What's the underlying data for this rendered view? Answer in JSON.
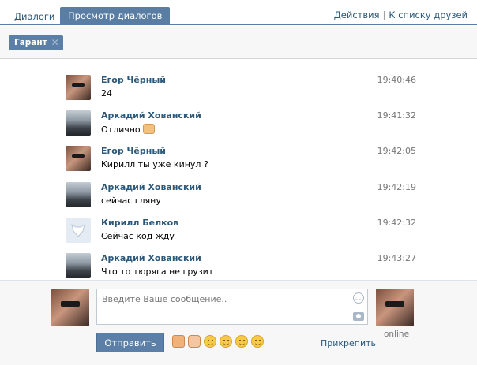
{
  "tabs": [
    {
      "label": "Диалоги",
      "active": false
    },
    {
      "label": "Просмотр диалогов",
      "active": true
    }
  ],
  "header_actions": {
    "actions": "Действия",
    "separator": "|",
    "friends": "К списку друзей"
  },
  "filter_chip": {
    "label": "Гарант"
  },
  "messages": [
    {
      "author": "Егор Чёрный",
      "text": "24",
      "time": "19:40:46",
      "avatar": "girl-photo"
    },
    {
      "author": "Аркадий Хованский",
      "text": "Отлично",
      "time": "19:41:32",
      "avatar": "car-photo",
      "emoji": "thumbs-up"
    },
    {
      "author": "Егор Чёрный",
      "text": "Кирилл ты уже кинул ?",
      "time": "19:42:05",
      "avatar": "girl-photo"
    },
    {
      "author": "Аркадий Хованский",
      "text": "сейчас гляну",
      "time": "19:42:19",
      "avatar": "car-photo"
    },
    {
      "author": "Кирилл Белков",
      "text": "Сейчас код жду",
      "time": "19:42:32",
      "avatar": "default-dog"
    },
    {
      "author": "Аркадий Хованский",
      "text": "Что то тюряга не грузит",
      "time": "19:43:27",
      "avatar": "car-photo"
    }
  ],
  "compose": {
    "placeholder": "Введите Ваше сообщение..",
    "send_label": "Отправить",
    "attach_label": "Прикрепить",
    "status": "online",
    "emojis": [
      "thumbs-down",
      "ok-hand",
      "laugh",
      "wink",
      "grin",
      "smile"
    ]
  },
  "colors": {
    "accent": "#597da3",
    "link": "#2b587a"
  }
}
